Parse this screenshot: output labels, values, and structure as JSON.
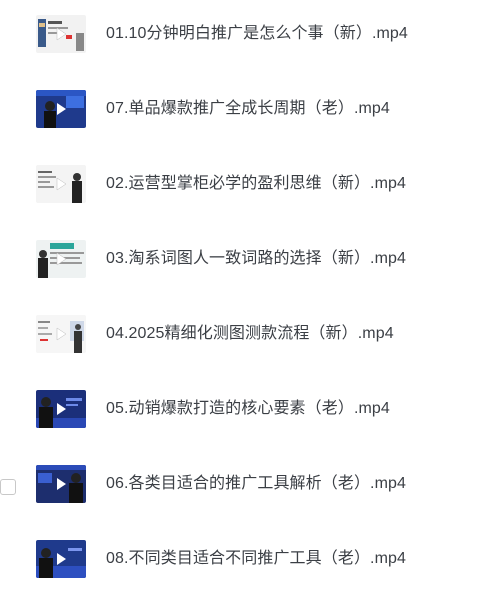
{
  "files": [
    {
      "name": "01.10分钟明白推广是怎么个事（新）.mp4",
      "thumbnail": "video-thumbnail-light",
      "selected": false
    },
    {
      "name": "07.单品爆款推广全成长周期（老）.mp4",
      "thumbnail": "video-thumbnail-blue",
      "selected": false
    },
    {
      "name": "02.运营型掌柜必学的盈利思维（新）.mp4",
      "thumbnail": "video-thumbnail-light",
      "selected": false
    },
    {
      "name": "03.淘系词图人一致词路的选择（新）.mp4",
      "thumbnail": "video-thumbnail-light",
      "selected": false
    },
    {
      "name": "04.2025精细化测图测款流程（新）.mp4",
      "thumbnail": "video-thumbnail-light",
      "selected": false
    },
    {
      "name": "05.动销爆款打造的核心要素（老）.mp4",
      "thumbnail": "video-thumbnail-blue",
      "selected": false
    },
    {
      "name": "06.各类目适合的推广工具解析（老）.mp4",
      "thumbnail": "video-thumbnail-blue",
      "selected": false
    },
    {
      "name": "08.不同类目适合不同推广工具（老）.mp4",
      "thumbnail": "video-thumbnail-blue",
      "selected": false
    }
  ],
  "colors": {
    "text": "#3b3f45",
    "thumb_blue": "#1f3a8c",
    "thumb_light": "#eeeeee"
  }
}
